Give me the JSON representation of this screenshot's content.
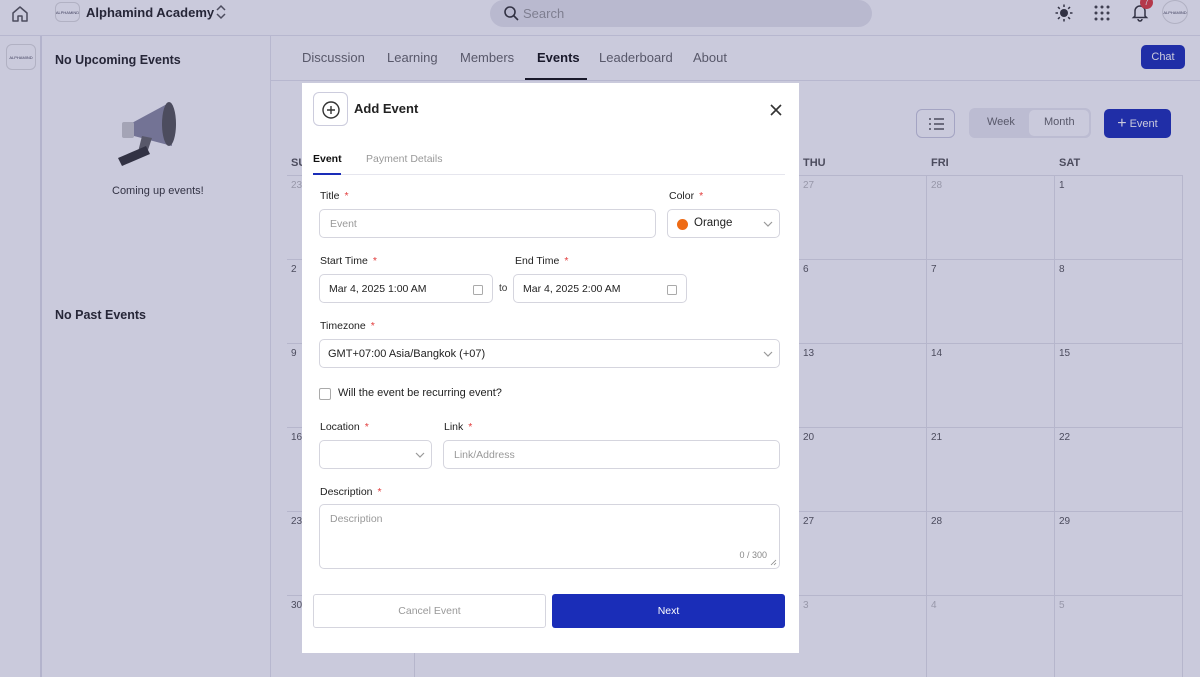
{
  "topbar": {
    "org_logo_text": "ALPHAMIND",
    "org_name": "Alphamind Academy",
    "search_placeholder": "Search",
    "notification_count": "7",
    "avatar_text": "ALPHAMIND"
  },
  "rail": {
    "logo_text": "ALPHAMIND"
  },
  "events_panel": {
    "upcoming_title": "No Upcoming Events",
    "upcoming_caption": "Coming up events!",
    "past_title": "No Past Events"
  },
  "community_tabs": {
    "tabs": [
      {
        "label": "Discussion"
      },
      {
        "label": "Learning"
      },
      {
        "label": "Members"
      },
      {
        "label": "Events"
      },
      {
        "label": "Leaderboard"
      },
      {
        "label": "About"
      }
    ],
    "active_tab": "Events",
    "chat_label": "Chat"
  },
  "calendar": {
    "view_week": "Week",
    "view_month": "Month",
    "selected_view": "Month",
    "add_event_label": "Event",
    "day_headers": [
      "SU",
      "THU",
      "FRI",
      "SAT"
    ],
    "rows": [
      [
        "23",
        "27",
        "28",
        "1"
      ],
      [
        "2",
        "6",
        "7",
        "8"
      ],
      [
        "9",
        "13",
        "14",
        "15"
      ],
      [
        "16",
        "20",
        "21",
        "22"
      ],
      [
        "23",
        "27",
        "28",
        "29"
      ],
      [
        "30",
        "3",
        "4",
        "5"
      ]
    ]
  },
  "modal": {
    "title": "Add Event",
    "tabs": [
      {
        "label": "Event"
      },
      {
        "label": "Payment Details"
      }
    ],
    "active_tab": "Event",
    "fields": {
      "title": {
        "label": "Title",
        "placeholder": "Event",
        "value": ""
      },
      "color": {
        "label": "Color",
        "value": "Orange",
        "swatch": "#ee6a14"
      },
      "start_time": {
        "label": "Start Time",
        "value": "Mar 4, 2025 1:00 AM"
      },
      "to_label": "to",
      "end_time": {
        "label": "End Time",
        "value": "Mar 4, 2025 2:00 AM"
      },
      "timezone": {
        "label": "Timezone",
        "value": "GMT+07:00 Asia/Bangkok (+07)"
      },
      "recurring": {
        "label": "Will the event be recurring event?",
        "checked": false
      },
      "location": {
        "label": "Location",
        "value": ""
      },
      "link": {
        "label": "Link",
        "placeholder": "Link/Address",
        "value": ""
      },
      "description": {
        "label": "Description",
        "placeholder": "Description",
        "counter": "0 / 300"
      }
    },
    "required_mark": "*",
    "cancel_label": "Cancel Event",
    "next_label": "Next"
  },
  "colors": {
    "primary": "#1a2db8",
    "required": "#e23b3b",
    "overlay": "rgba(52,50,120,0.26)"
  }
}
